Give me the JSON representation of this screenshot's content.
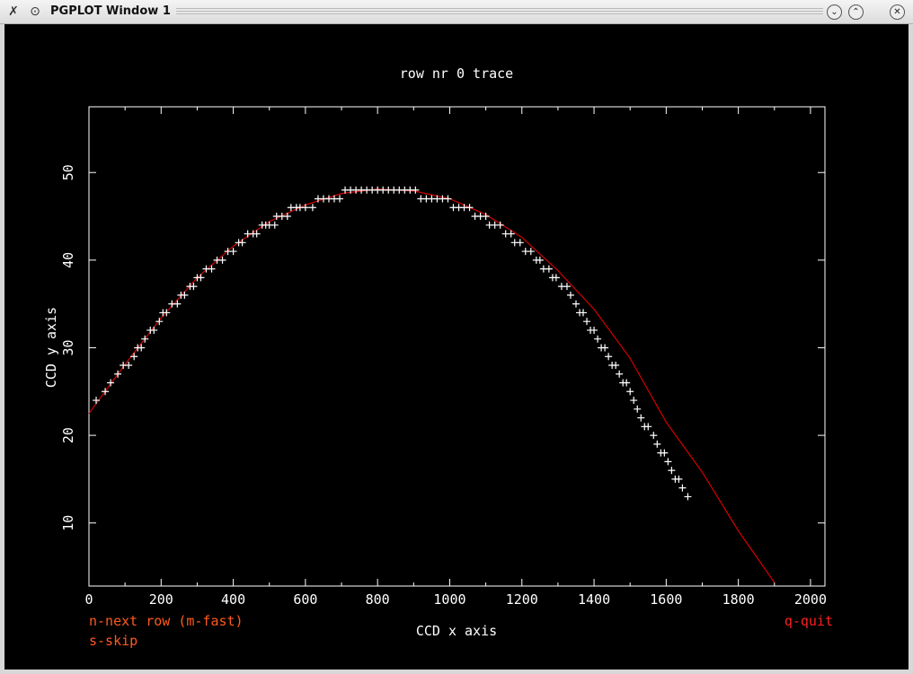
{
  "window": {
    "title": "PGPLOT Window 1",
    "icons": [
      "x11-logo-icon",
      "pin-icon",
      "minimize-icon",
      "maximize-icon",
      "close-icon"
    ],
    "buttons": {
      "minimize": "⌄",
      "maximize": "⌃",
      "close": "✕"
    }
  },
  "colors": {
    "background": "#000000",
    "axes": "#ffffff",
    "fit_line": "#d40000",
    "points": "#ffffff",
    "help_text": "#ff5a1e",
    "quit_text": "#ff2020"
  },
  "chart_data": {
    "type": "scatter",
    "title": "row nr 0 trace",
    "xlabel": "CCD x axis",
    "ylabel": "CCD y axis",
    "xlim": [
      0,
      2040
    ],
    "ylim": [
      2.8,
      57.5
    ],
    "xticks": [
      0,
      200,
      400,
      600,
      800,
      1000,
      1200,
      1400,
      1600,
      1800,
      2000
    ],
    "yticks": [
      10,
      20,
      30,
      40,
      50
    ],
    "points": [
      [
        20,
        24
      ],
      [
        45,
        25
      ],
      [
        60,
        26
      ],
      [
        80,
        27
      ],
      [
        95,
        28
      ],
      [
        110,
        28
      ],
      [
        125,
        29
      ],
      [
        135,
        30
      ],
      [
        145,
        30
      ],
      [
        155,
        31
      ],
      [
        170,
        32
      ],
      [
        180,
        32
      ],
      [
        195,
        33
      ],
      [
        205,
        34
      ],
      [
        215,
        34
      ],
      [
        230,
        35
      ],
      [
        245,
        35
      ],
      [
        255,
        36
      ],
      [
        265,
        36
      ],
      [
        280,
        37
      ],
      [
        290,
        37
      ],
      [
        300,
        38
      ],
      [
        310,
        38
      ],
      [
        325,
        39
      ],
      [
        340,
        39
      ],
      [
        355,
        40
      ],
      [
        370,
        40
      ],
      [
        385,
        41
      ],
      [
        400,
        41
      ],
      [
        415,
        42
      ],
      [
        425,
        42
      ],
      [
        440,
        43
      ],
      [
        455,
        43
      ],
      [
        465,
        43
      ],
      [
        480,
        44
      ],
      [
        490,
        44
      ],
      [
        500,
        44
      ],
      [
        515,
        44
      ],
      [
        520,
        45
      ],
      [
        535,
        45
      ],
      [
        550,
        45
      ],
      [
        560,
        46
      ],
      [
        575,
        46
      ],
      [
        585,
        46
      ],
      [
        600,
        46
      ],
      [
        620,
        46
      ],
      [
        635,
        47
      ],
      [
        650,
        47
      ],
      [
        665,
        47
      ],
      [
        680,
        47
      ],
      [
        695,
        47
      ],
      [
        710,
        48
      ],
      [
        725,
        48
      ],
      [
        740,
        48
      ],
      [
        755,
        48
      ],
      [
        770,
        48
      ],
      [
        785,
        48
      ],
      [
        800,
        48
      ],
      [
        815,
        48
      ],
      [
        830,
        48
      ],
      [
        845,
        48
      ],
      [
        860,
        48
      ],
      [
        875,
        48
      ],
      [
        890,
        48
      ],
      [
        905,
        48
      ],
      [
        920,
        47
      ],
      [
        935,
        47
      ],
      [
        950,
        47
      ],
      [
        965,
        47
      ],
      [
        980,
        47
      ],
      [
        995,
        47
      ],
      [
        1010,
        46
      ],
      [
        1025,
        46
      ],
      [
        1040,
        46
      ],
      [
        1055,
        46
      ],
      [
        1070,
        45
      ],
      [
        1085,
        45
      ],
      [
        1100,
        45
      ],
      [
        1110,
        44
      ],
      [
        1125,
        44
      ],
      [
        1140,
        44
      ],
      [
        1155,
        43
      ],
      [
        1170,
        43
      ],
      [
        1180,
        42
      ],
      [
        1195,
        42
      ],
      [
        1210,
        41
      ],
      [
        1225,
        41
      ],
      [
        1240,
        40
      ],
      [
        1250,
        40
      ],
      [
        1260,
        39
      ],
      [
        1275,
        39
      ],
      [
        1285,
        38
      ],
      [
        1295,
        38
      ],
      [
        1310,
        37
      ],
      [
        1325,
        37
      ],
      [
        1335,
        36
      ],
      [
        1350,
        35
      ],
      [
        1360,
        34
      ],
      [
        1370,
        34
      ],
      [
        1380,
        33
      ],
      [
        1390,
        32
      ],
      [
        1400,
        32
      ],
      [
        1410,
        31
      ],
      [
        1420,
        30
      ],
      [
        1430,
        30
      ],
      [
        1440,
        29
      ],
      [
        1450,
        28
      ],
      [
        1460,
        28
      ],
      [
        1470,
        27
      ],
      [
        1480,
        26
      ],
      [
        1490,
        26
      ],
      [
        1500,
        25
      ],
      [
        1510,
        24
      ],
      [
        1520,
        23
      ],
      [
        1530,
        22
      ],
      [
        1540,
        21
      ],
      [
        1550,
        21
      ],
      [
        1565,
        20
      ],
      [
        1575,
        19
      ],
      [
        1585,
        18
      ],
      [
        1595,
        18
      ],
      [
        1605,
        17
      ],
      [
        1615,
        16
      ],
      [
        1625,
        15
      ],
      [
        1635,
        15
      ],
      [
        1645,
        14
      ],
      [
        1660,
        13
      ]
    ],
    "fit_line": [
      [
        0,
        22.5
      ],
      [
        100,
        28.1
      ],
      [
        200,
        33.4
      ],
      [
        300,
        38
      ],
      [
        400,
        41.6
      ],
      [
        500,
        44.4
      ],
      [
        600,
        46.3
      ],
      [
        700,
        47.6
      ],
      [
        800,
        48.1
      ],
      [
        900,
        47.9
      ],
      [
        1000,
        47
      ],
      [
        1100,
        45.2
      ],
      [
        1200,
        42.6
      ],
      [
        1300,
        38.8
      ],
      [
        1400,
        34.4
      ],
      [
        1500,
        28.8
      ],
      [
        1600,
        21.5
      ],
      [
        1700,
        15.8
      ],
      [
        1800,
        9.1
      ],
      [
        1900,
        3.2
      ]
    ]
  },
  "help": {
    "next_row": "n-next row (m-fast)",
    "skip": "s-skip",
    "quit": "q-quit"
  }
}
